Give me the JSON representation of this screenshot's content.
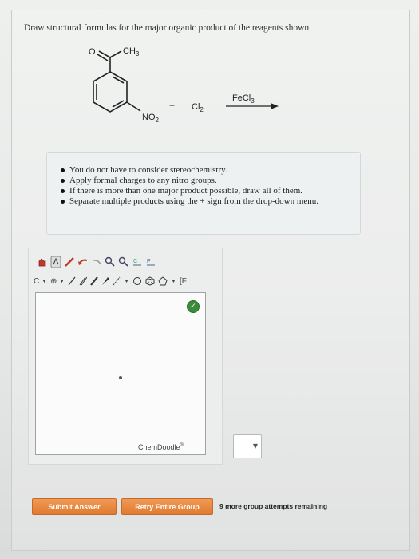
{
  "question": {
    "text": "Draw structural formulas for the major organic product of the reagents shown."
  },
  "reaction": {
    "substituent_top_O": "O",
    "substituent_top_CH3": "CH",
    "substituent_top_CH3_sub": "3",
    "substituent_bottom": "NO",
    "substituent_bottom_sub": "2",
    "plus": "+",
    "reagent_cl": "Cl",
    "reagent_cl_sub": "2",
    "catalyst": "FeCl",
    "catalyst_sub": "3"
  },
  "rules": [
    "You do not have to consider stereochemistry.",
    "Apply formal charges to any nitro groups.",
    "If there is more than one major product possible, draw all of them.",
    "Separate multiple products using the + sign from the drop-down menu."
  ],
  "editor": {
    "toolbar_atom": "C",
    "toolbar_text": "[F",
    "brand_name": "ChemDoodle",
    "brand_mark": "®"
  },
  "buttons": {
    "submit": "Submit Answer",
    "retry": "Retry Entire Group"
  },
  "status": {
    "remaining": "9 more group attempts remaining"
  },
  "colors": {
    "button_orange": "#e98a41",
    "badge_green": "#3a8b3a"
  }
}
